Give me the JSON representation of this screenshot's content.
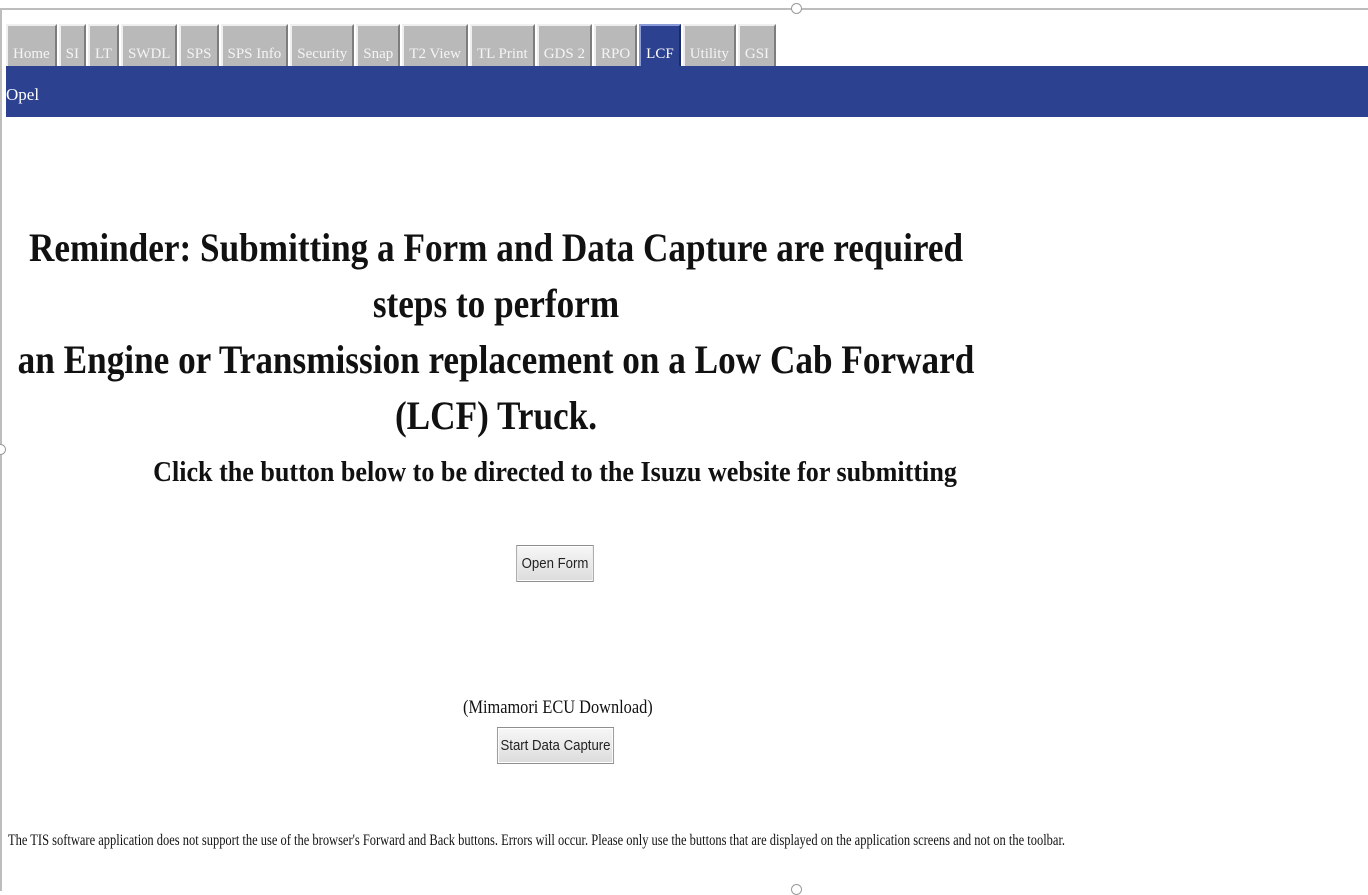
{
  "tabs": [
    {
      "label": "Home",
      "active": false
    },
    {
      "label": "SI",
      "active": false
    },
    {
      "label": "LT",
      "active": false
    },
    {
      "label": "SWDL",
      "active": false
    },
    {
      "label": "SPS",
      "active": false
    },
    {
      "label": "SPS Info",
      "active": false
    },
    {
      "label": "Security",
      "active": false
    },
    {
      "label": "Snap",
      "active": false
    },
    {
      "label": "T2 View",
      "active": false
    },
    {
      "label": "TL Print",
      "active": false
    },
    {
      "label": "GDS 2",
      "active": false
    },
    {
      "label": "RPO",
      "active": false
    },
    {
      "label": "LCF",
      "active": true
    },
    {
      "label": "Utility",
      "active": false
    },
    {
      "label": "GSI",
      "active": false
    }
  ],
  "header": {
    "brand": "Opel"
  },
  "main": {
    "reminder_line1": "Reminder: Submitting a Form and Data Capture are required steps to perform",
    "reminder_line2": "an Engine or Transmission replacement on a Low Cab Forward (LCF) Truck.",
    "instruction": "Click the button below to be directed to the Isuzu website for submitting",
    "open_form_label": "Open Form",
    "capture_caption": "(Mimamori ECU Download)",
    "start_capture_label": "Start Data Capture"
  },
  "footer": {
    "notice": "The TIS software application does not support the use of the browser's Forward and Back buttons. Errors will occur. Please only use the buttons that are displayed on the application screens and not on the toolbar."
  },
  "colors": {
    "accent": "#2c4190",
    "tab_inactive": "#b9b9b9"
  }
}
